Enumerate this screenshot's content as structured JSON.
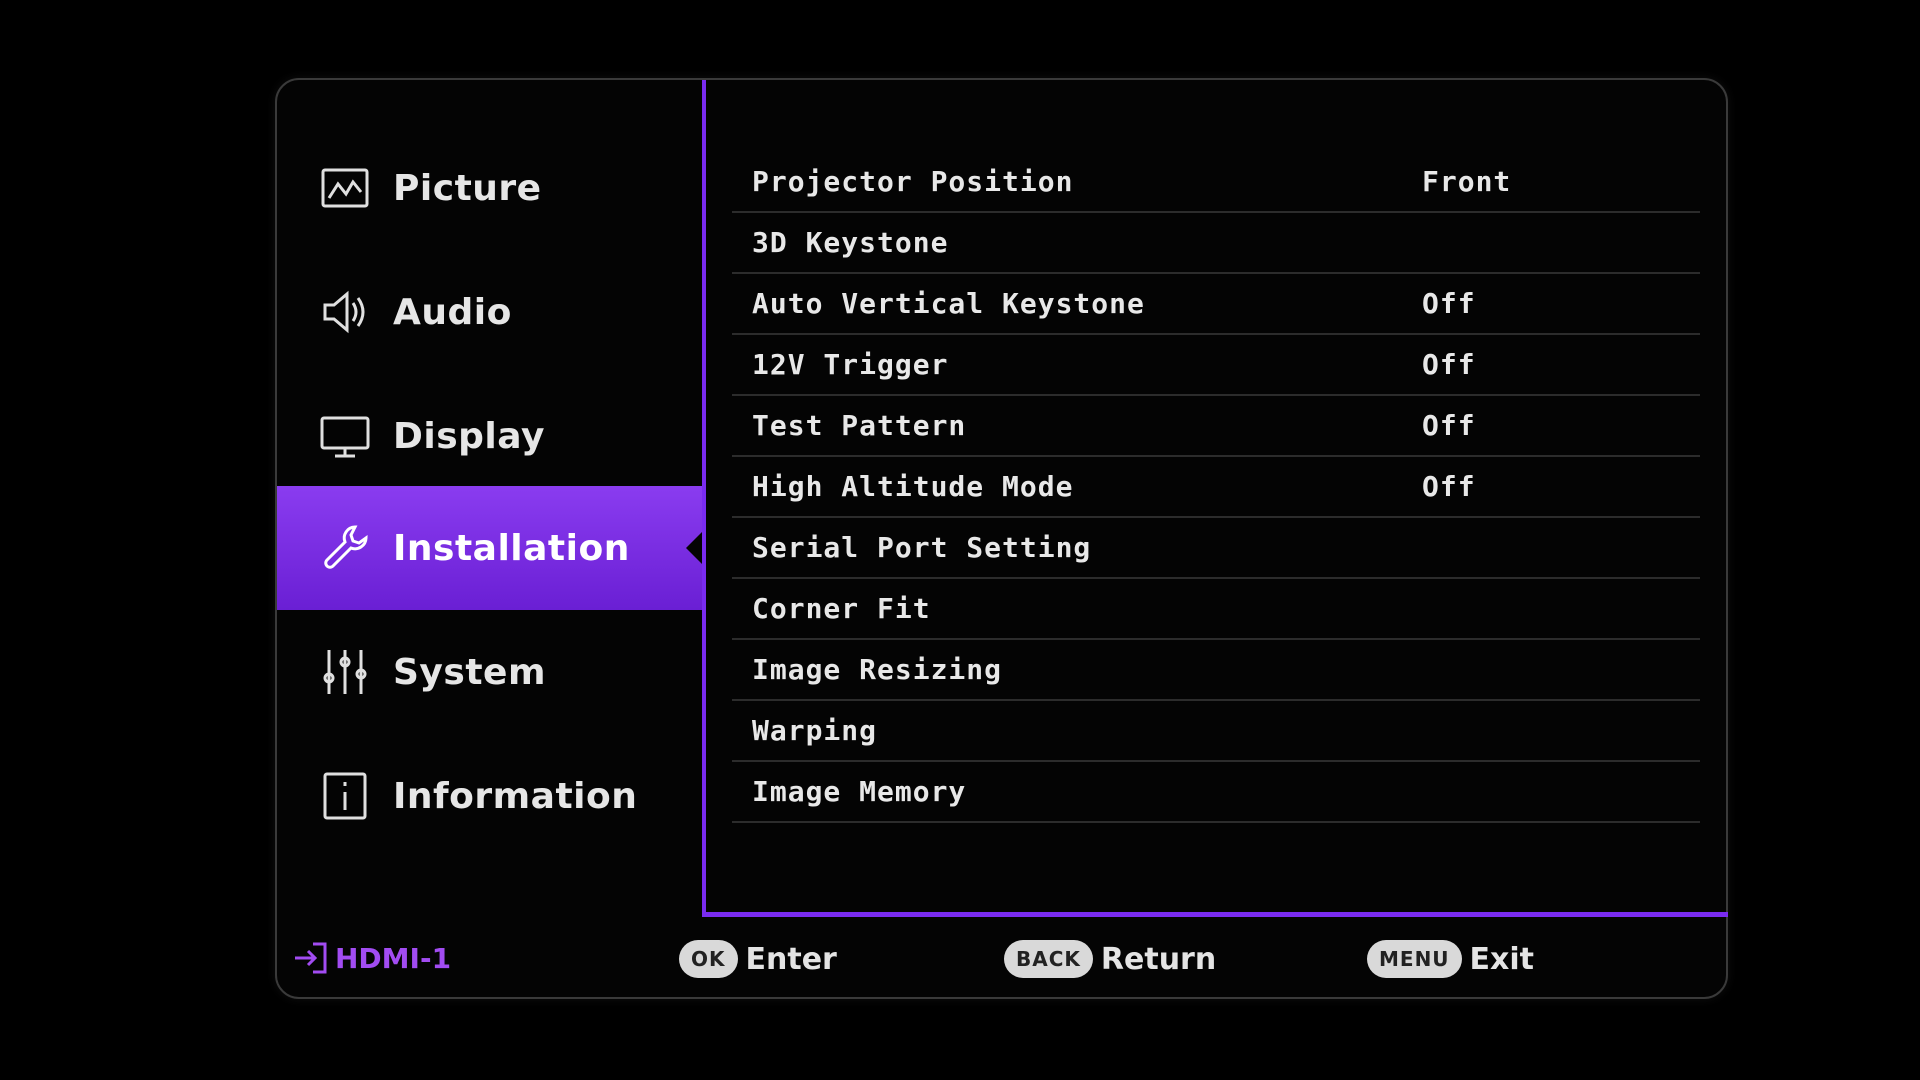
{
  "sidebar": {
    "items": [
      {
        "label": "Picture",
        "icon": "picture-icon",
        "active": false
      },
      {
        "label": "Audio",
        "icon": "speaker-icon",
        "active": false
      },
      {
        "label": "Display",
        "icon": "monitor-icon",
        "active": false
      },
      {
        "label": "Installation",
        "icon": "wrench-icon",
        "active": true
      },
      {
        "label": "System",
        "icon": "sliders-icon",
        "active": false
      },
      {
        "label": "Information",
        "icon": "info-icon",
        "active": false
      }
    ]
  },
  "settings": {
    "rows": [
      {
        "name": "Projector Position",
        "value": "Front"
      },
      {
        "name": "3D Keystone",
        "value": ""
      },
      {
        "name": "Auto Vertical Keystone",
        "value": "Off"
      },
      {
        "name": "12V Trigger",
        "value": "Off"
      },
      {
        "name": "Test Pattern",
        "value": "Off"
      },
      {
        "name": "High Altitude Mode",
        "value": "Off"
      },
      {
        "name": "Serial Port Setting",
        "value": ""
      },
      {
        "name": "Corner Fit",
        "value": ""
      },
      {
        "name": "Image Resizing",
        "value": ""
      },
      {
        "name": "Warping",
        "value": ""
      },
      {
        "name": "Image Memory",
        "value": ""
      }
    ]
  },
  "footer": {
    "source": "HDMI-1",
    "hints": [
      {
        "key": "OK",
        "label": "Enter"
      },
      {
        "key": "BACK",
        "label": "Return"
      },
      {
        "key": "MENU",
        "label": "Exit"
      }
    ]
  },
  "colors": {
    "accent": "#7a2bf0",
    "active_bg": "#8a3cf0",
    "source_text": "#a24cf2"
  }
}
